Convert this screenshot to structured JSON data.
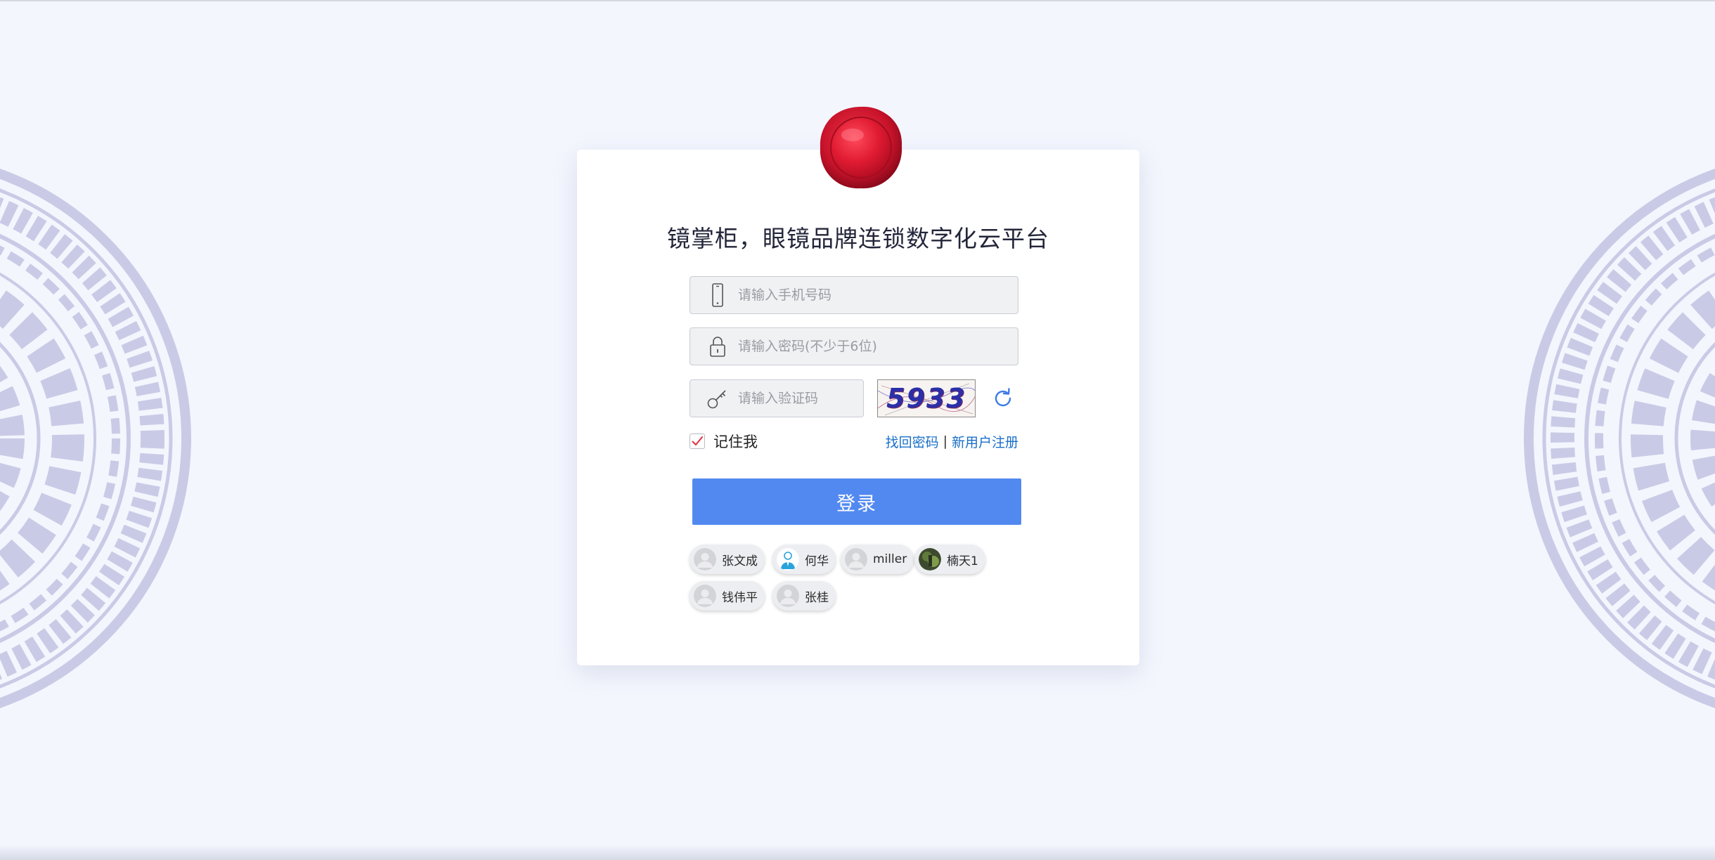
{
  "app": {
    "title": "镜掌柜，眼镜品牌连锁数字化云平台",
    "logo_icon": "red-wax-seal-icon"
  },
  "form": {
    "phone": {
      "placeholder": "请输入手机号码",
      "value": "",
      "icon": "mobile-phone-icon"
    },
    "password": {
      "placeholder": "请输入密码(不少于6位)",
      "value": "",
      "icon": "lock-icon"
    },
    "captcha_input": {
      "placeholder": "请输入验证码",
      "value": "",
      "icon": "key-icon"
    },
    "captcha_image_text": "5933",
    "refresh_icon": "refresh-icon",
    "remember_label": "记住我",
    "remember_checked": true,
    "forgot_password": "找回密码",
    "separator": "|",
    "register": "新用户注册",
    "login_button": "登录"
  },
  "quick_users": [
    {
      "name": "张文成",
      "avatar": "default-avatar-icon"
    },
    {
      "name": "何华",
      "avatar": "businessman-avatar-icon"
    },
    {
      "name": "miller",
      "avatar": "default-avatar-icon"
    },
    {
      "name": "楠天1",
      "avatar": "photo-avatar"
    },
    {
      "name": "钱伟平",
      "avatar": "default-avatar-icon"
    },
    {
      "name": "张桂",
      "avatar": "default-avatar-icon"
    }
  ],
  "colors": {
    "background": "#f3f6fd",
    "accent": "#5289f0",
    "link": "#1a6fc9",
    "ornament": "#c9cbe6",
    "seal": "#d41a2e"
  }
}
